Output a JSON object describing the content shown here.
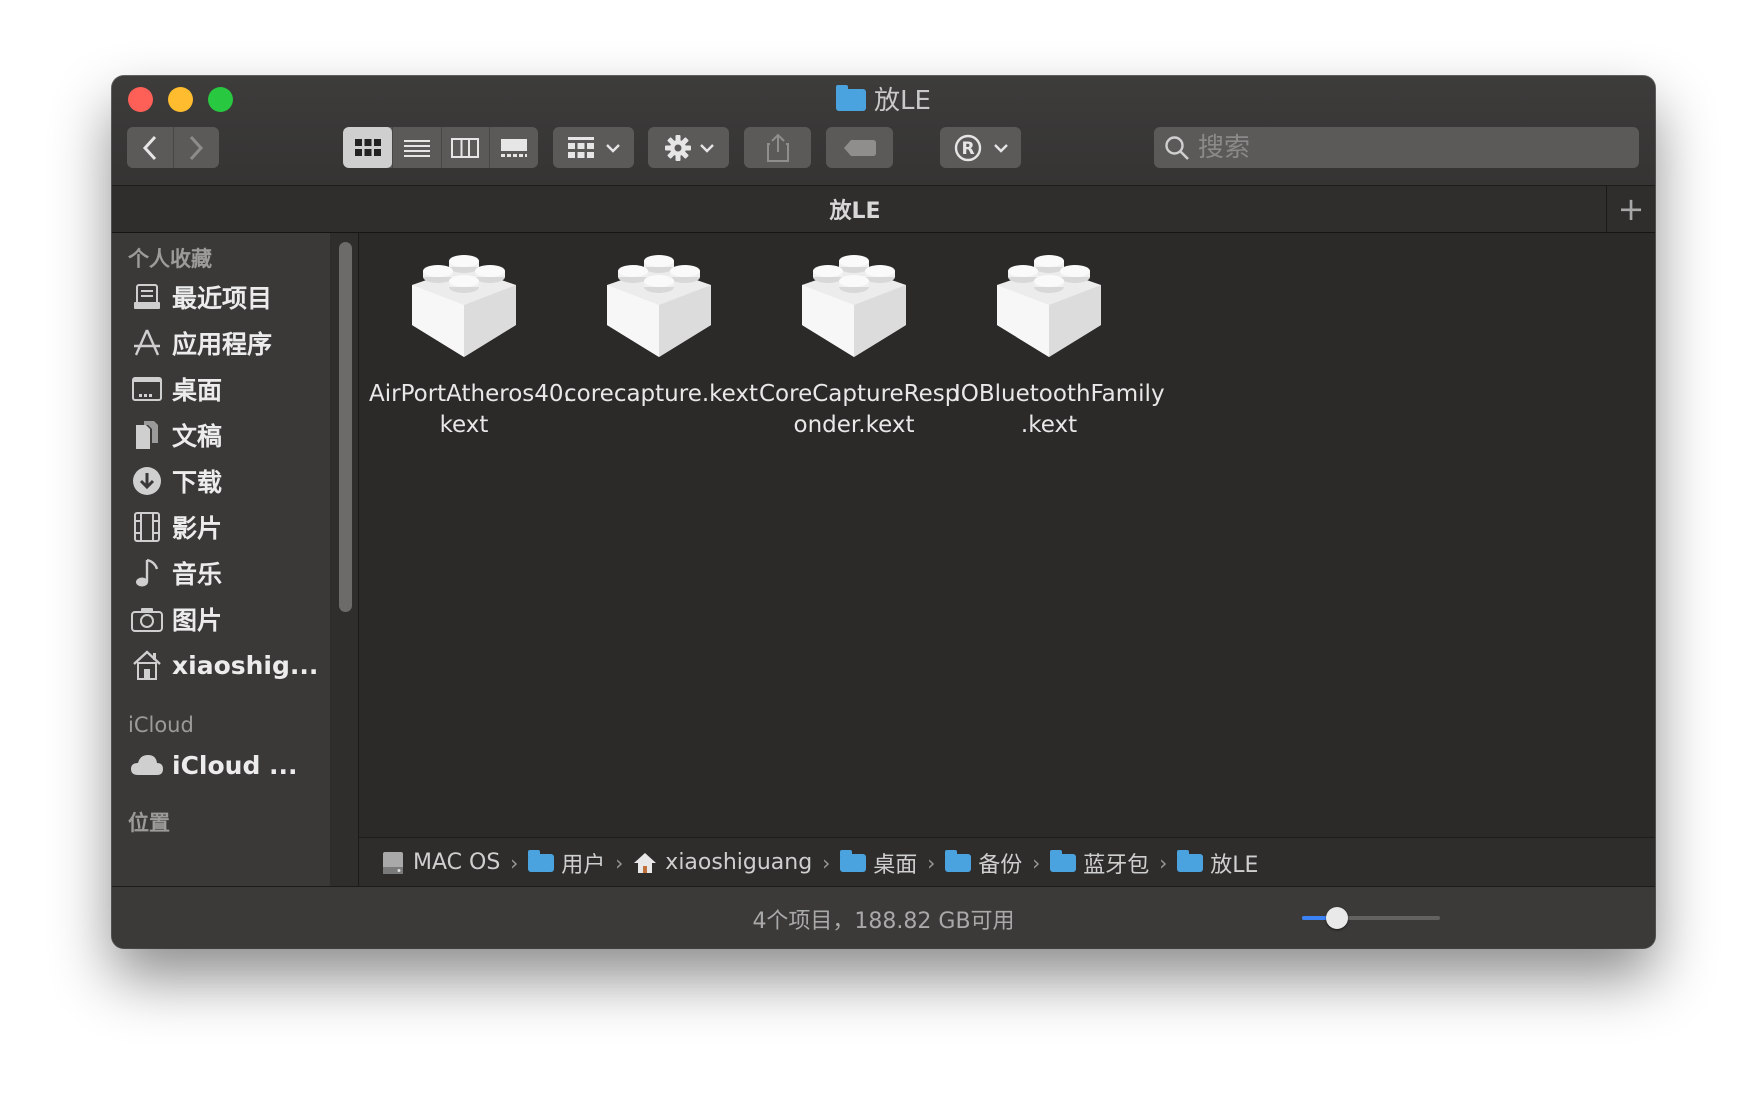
{
  "window": {
    "title": "放LE"
  },
  "toolbar": {
    "back_label": "‹",
    "forward_label": "›",
    "search_placeholder": "搜索"
  },
  "tab": {
    "title": "放LE",
    "add_label": "+"
  },
  "sidebar": {
    "favorites_header": "个人收藏",
    "items": [
      {
        "label": "最近项目",
        "icon": "recents-icon"
      },
      {
        "label": "应用程序",
        "icon": "applications-icon"
      },
      {
        "label": "桌面",
        "icon": "desktop-icon"
      },
      {
        "label": "文稿",
        "icon": "documents-icon"
      },
      {
        "label": "下载",
        "icon": "downloads-icon"
      },
      {
        "label": "影片",
        "icon": "movies-icon"
      },
      {
        "label": "音乐",
        "icon": "music-icon"
      },
      {
        "label": "图片",
        "icon": "pictures-icon"
      },
      {
        "label": "xiaoshig...",
        "icon": "home-icon"
      }
    ],
    "icloud_header": "iCloud",
    "icloud_items": [
      {
        "label": "iCloud ...",
        "icon": "icloud-icon"
      }
    ],
    "locations_header": "位置"
  },
  "files": [
    {
      "name_line1": "AirPortAtheros40.",
      "name_line2": "kext"
    },
    {
      "name_line1": "corecapture.kext",
      "name_line2": ""
    },
    {
      "name_line1": "CoreCaptureResp",
      "name_line2": "onder.kext"
    },
    {
      "name_line1": "IOBluetoothFamily",
      "name_line2": ".kext"
    }
  ],
  "path": [
    "MAC OS",
    "用户",
    "xiaoshiguang",
    "桌面",
    "备份",
    "蓝牙包",
    "放LE"
  ],
  "status": {
    "text": "4个项目，188.82 GB可用",
    "icon_size_fraction": 0.25
  },
  "colors": {
    "accent": "#3b82f6",
    "folder": "#4aa3df",
    "close": "#fe5f57",
    "minimize": "#febc2e",
    "maximize": "#28c840"
  }
}
